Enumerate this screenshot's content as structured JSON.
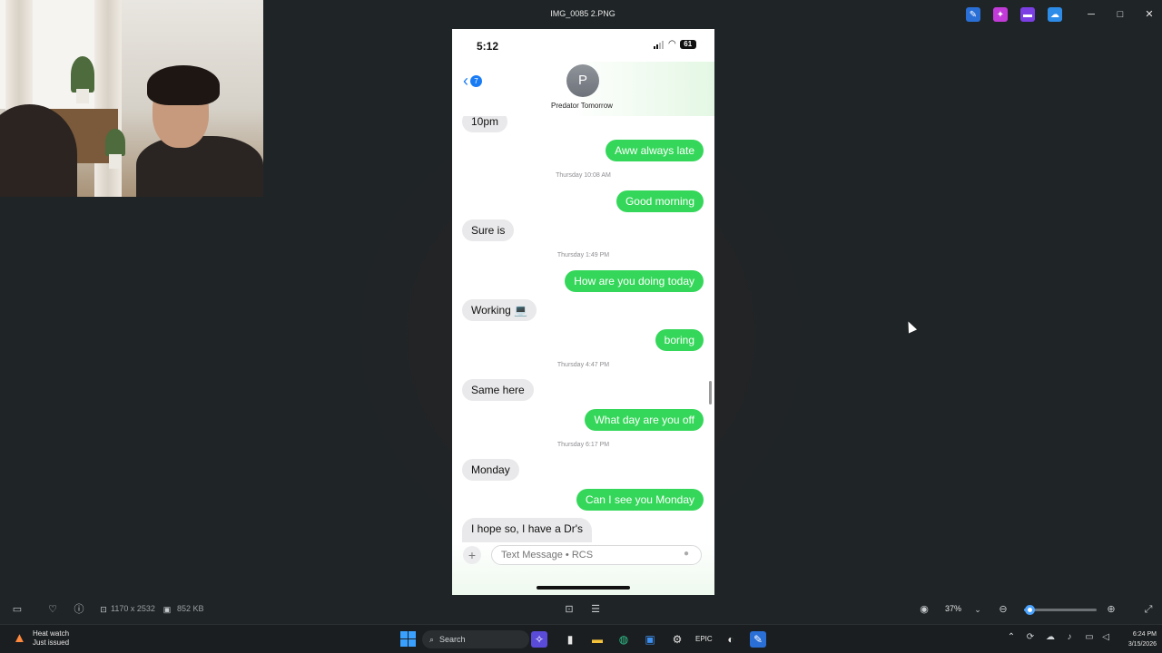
{
  "window": {
    "title": "IMG_0085 2.PNG",
    "titlebar_icons": [
      "pin-icon",
      "copilot-icon",
      "clipchamp-icon",
      "onedrive-icon"
    ],
    "minimize": "─",
    "maximize": "□",
    "close": "✕"
  },
  "phone": {
    "status_time": "5:12",
    "battery": "61",
    "back_badge": "7",
    "contact_initial": "P",
    "contact_name": "Predator Tomorrow",
    "composer_placeholder": "Text Message • RCS",
    "messages": [
      {
        "dir": "in",
        "text": "10pm"
      },
      {
        "dir": "out",
        "text": "Aww always late"
      },
      {
        "dir": "stamp",
        "text": "Thursday 10:08 AM"
      },
      {
        "dir": "out",
        "text": "Good morning"
      },
      {
        "dir": "in",
        "text": "Sure is"
      },
      {
        "dir": "stamp",
        "text": "Thursday 1:49 PM"
      },
      {
        "dir": "out",
        "text": "How are you doing today"
      },
      {
        "dir": "in",
        "text": "Working 💻"
      },
      {
        "dir": "out",
        "text": "boring"
      },
      {
        "dir": "stamp",
        "text": "Thursday 4:47 PM"
      },
      {
        "dir": "in",
        "text": "Same here"
      },
      {
        "dir": "out",
        "text": "What day are you off"
      },
      {
        "dir": "stamp",
        "text": "Thursday 6:17 PM"
      },
      {
        "dir": "in",
        "text": "Monday"
      },
      {
        "dir": "out",
        "text": "Can I see you Monday"
      },
      {
        "dir": "in",
        "text": "I hope so, I have a Dr's"
      }
    ]
  },
  "viewer_bar": {
    "dimensions": "1170 x 2532",
    "file_size": "852 KB",
    "zoom": "37%",
    "zoom_level": 0.37
  },
  "taskbar": {
    "weather_title": "Heat watch",
    "weather_sub": "Just issued",
    "search_label": "Search",
    "time": "6:24 PM",
    "date": "3/15/2026"
  },
  "colors": {
    "imessage_green": "#35d75a",
    "incoming_gray": "#e9e9eb",
    "ios_blue": "#1a7cf5",
    "background": "#1f2426"
  }
}
